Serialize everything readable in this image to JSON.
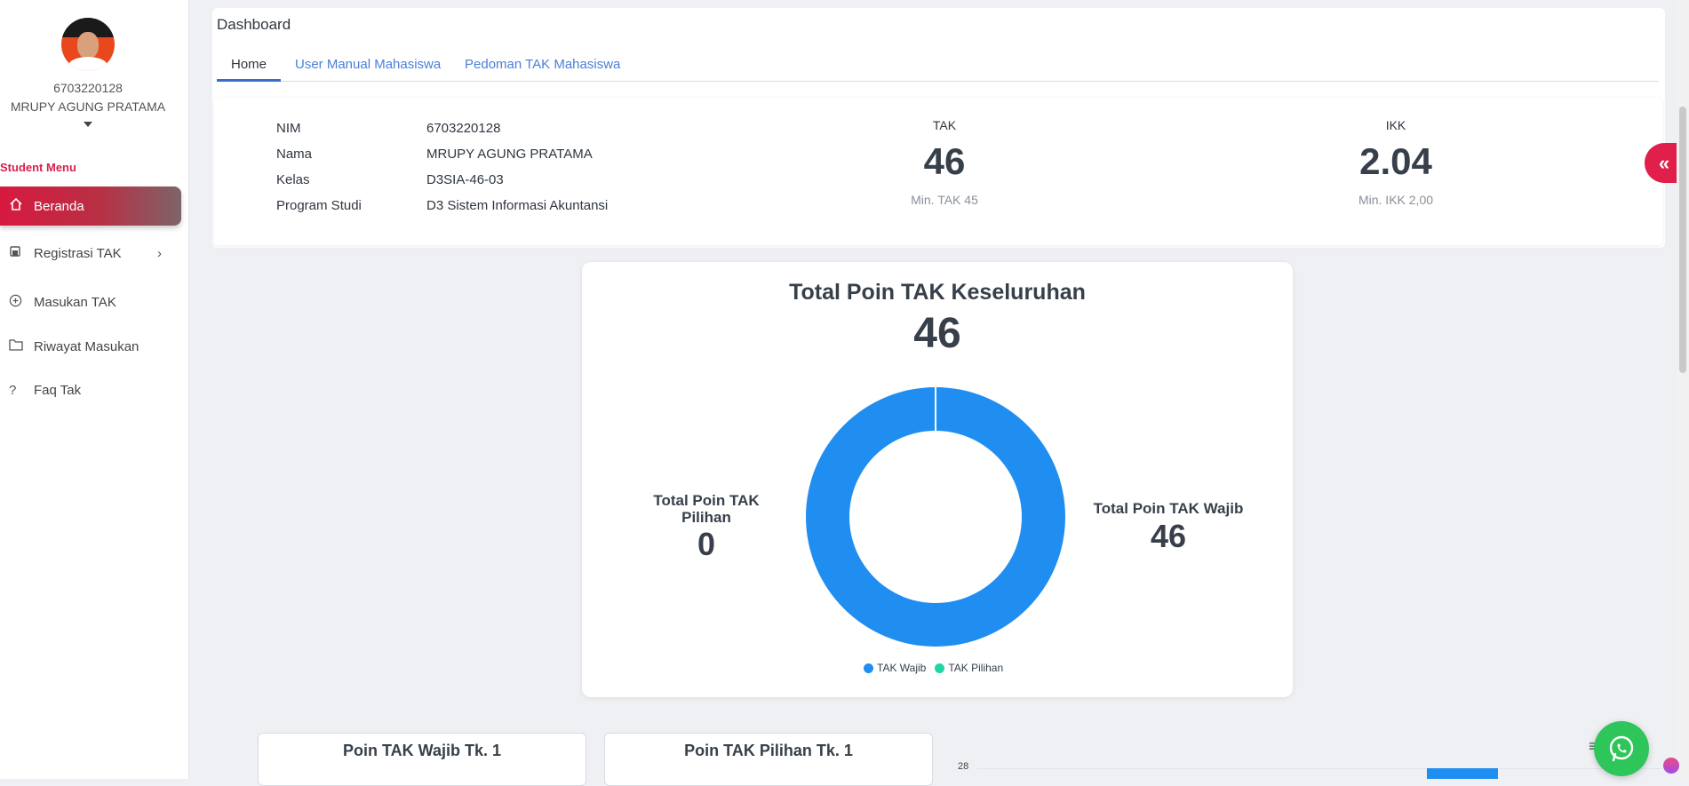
{
  "user": {
    "nim": "6703220128",
    "name": "MRUPY AGUNG PRATAMA"
  },
  "sidebar": {
    "title": "Student Menu",
    "items": [
      {
        "label": "Beranda",
        "icon": "home-icon"
      },
      {
        "label": "Registrasi TAK",
        "icon": "register-icon"
      },
      {
        "label": "Masukan TAK",
        "icon": "plus-circle-icon"
      },
      {
        "label": "Riwayat Masukan",
        "icon": "folder-icon"
      },
      {
        "label": "Faq Tak",
        "icon": "question-icon"
      }
    ]
  },
  "header": {
    "title": "Dashboard",
    "tabs": [
      {
        "label": "Home"
      },
      {
        "label": "User Manual Mahasiswa"
      },
      {
        "label": "Pedoman TAK Mahasiswa"
      }
    ]
  },
  "profile": {
    "rows": [
      {
        "label": "NIM",
        "value": "6703220128"
      },
      {
        "label": "Nama",
        "value": "MRUPY AGUNG PRATAMA"
      },
      {
        "label": "Kelas",
        "value": "D3SIA-46-03"
      },
      {
        "label": "Program Studi",
        "value": "D3 Sistem Informasi Akuntansi"
      }
    ]
  },
  "stats": {
    "tak": {
      "label": "TAK",
      "value": "46",
      "min": "Min. TAK 45"
    },
    "ikk": {
      "label": "IKK",
      "value": "2.04",
      "min": "Min. IKK 2,00"
    }
  },
  "collapse_button": "«",
  "donut": {
    "title": "Total Poin TAK Keseluruhan",
    "total": "46",
    "left_label": "Total Poin TAK Pilihan",
    "left_value": "0",
    "right_label": "Total Poin TAK Wajib",
    "right_value": "46"
  },
  "chart_data": {
    "type": "pie",
    "categories": [
      "TAK Wajib",
      "TAK Pilihan"
    ],
    "values": [
      46,
      0
    ],
    "colors": [
      "#1f8ef0",
      "#1ed6a0"
    ],
    "legend": "bottom"
  },
  "bottom": {
    "card1_title": "Poin TAK Wajib Tk. 1",
    "card2_title": "Poin TAK Pilihan Tk. 1",
    "tick_label": "28"
  },
  "colors": {
    "accent": "#d6204e",
    "donut_wajib": "#1f8ef0",
    "donut_pilihan": "#1ed6a0",
    "whatsapp": "#2ec65a"
  }
}
